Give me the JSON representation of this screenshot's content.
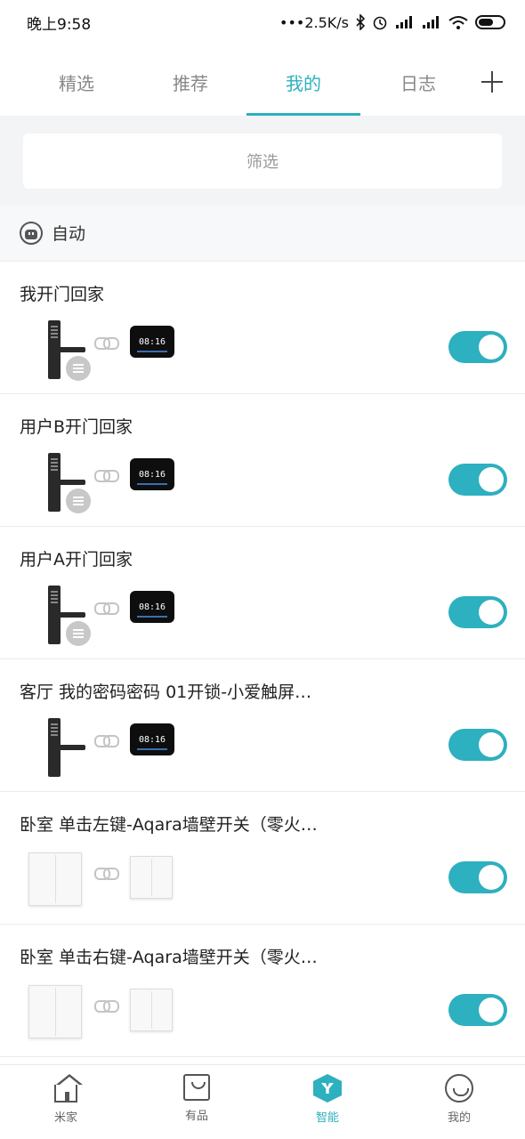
{
  "status_bar": {
    "time": "晚上9:58",
    "network_speed": "•••2.5K/s",
    "icons": [
      "bluetooth-icon",
      "alarm-icon",
      "signal-icon",
      "hd-signal-icon",
      "wifi-icon",
      "battery-icon"
    ]
  },
  "tabs": [
    {
      "label": "精选",
      "active": false
    },
    {
      "label": "推荐",
      "active": false
    },
    {
      "label": "我的",
      "active": true
    },
    {
      "label": "日志",
      "active": false
    }
  ],
  "filter": {
    "label": "筛选"
  },
  "section": {
    "label": "自动"
  },
  "rows": [
    {
      "title": "我开门回家",
      "devices": "lock-to-screen",
      "screen_time": "08:16",
      "waiting": true,
      "enabled": true
    },
    {
      "title": "用户B开门回家",
      "devices": "lock-to-screen",
      "screen_time": "08:16",
      "waiting": true,
      "enabled": true
    },
    {
      "title": "用户A开门回家",
      "devices": "lock-to-screen",
      "screen_time": "08:16",
      "waiting": true,
      "enabled": true
    },
    {
      "title": "客厅 我的密码密码 01开锁-小爱触屏…",
      "devices": "lock-to-screen",
      "screen_time": "08:16",
      "waiting": false,
      "enabled": true
    },
    {
      "title": "卧室 单击左键-Aqara墙壁开关（零火…",
      "devices": "switch-to-switch",
      "enabled": true
    },
    {
      "title": "卧室 单击右键-Aqara墙壁开关（零火…",
      "devices": "switch-to-switch",
      "enabled": true
    }
  ],
  "bottom_nav": [
    {
      "label": "米家",
      "icon": "home-icon",
      "active": false
    },
    {
      "label": "有品",
      "icon": "shop-bag-icon",
      "active": false
    },
    {
      "label": "智能",
      "icon": "smart-icon",
      "active": true
    },
    {
      "label": "我的",
      "icon": "profile-icon",
      "active": false
    }
  ],
  "colors": {
    "accent": "#2db0bf",
    "background": "#f3f4f5"
  }
}
